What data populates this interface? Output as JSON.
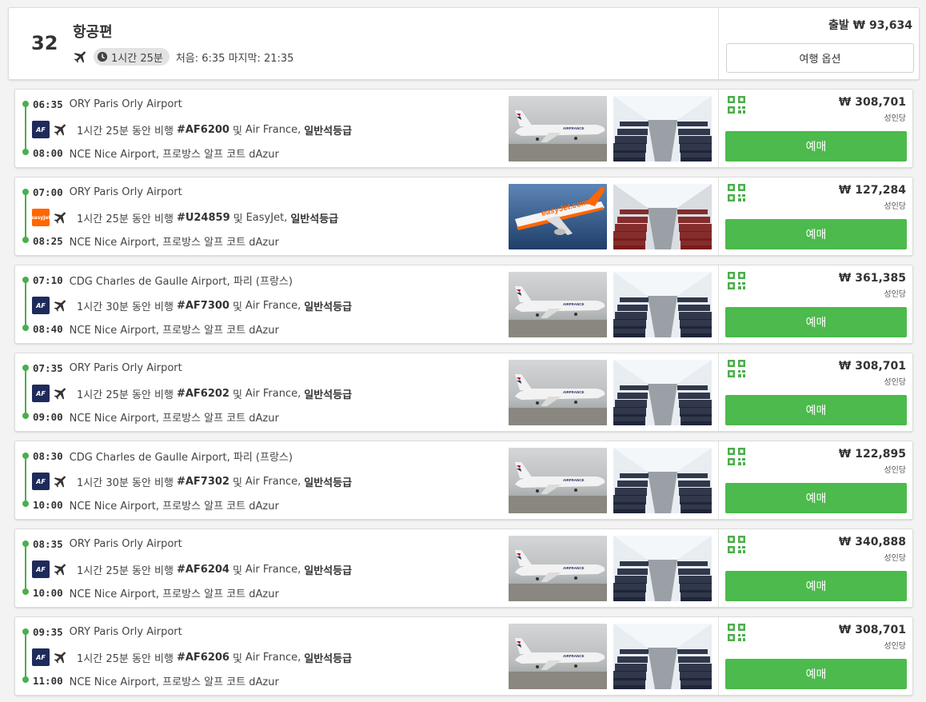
{
  "summary": {
    "count": "32",
    "title": "항공편",
    "duration": "1시간 25분",
    "first_last": "처음: 6:35 마지막: 21:35",
    "depart_price": "출발 ₩ 93,634",
    "options_label": "여행 옵션"
  },
  "book_label": "예매",
  "per_person": "성인당",
  "colors": {
    "accent_green": "#4cba4c",
    "airfrance_navy": "#1f2a5c",
    "easyjet_orange": "#ff6600"
  },
  "flights": [
    {
      "dep_time": "06:35",
      "dep_place": "ORY Paris Orly Airport",
      "duration": "1시간 25분 동안 비행",
      "flight_no": "#AF6200",
      "and": "및",
      "airline": "Air France,",
      "cabin": "일반석등급",
      "arr_time": "08:00",
      "arr_place": "NCE Nice Airport, 프로방스 알프 코트 dAzur",
      "price": "₩ 308,701",
      "logo": "AF"
    },
    {
      "dep_time": "07:00",
      "dep_place": "ORY Paris Orly Airport",
      "duration": "1시간 25분 동안 비행",
      "flight_no": "#U24859",
      "and": "및",
      "airline": "EasyJet,",
      "cabin": "일반석등급",
      "arr_time": "08:25",
      "arr_place": "NCE Nice Airport, 프로방스 알프 코트 dAzur",
      "price": "₩ 127,284",
      "logo": "easyJet"
    },
    {
      "dep_time": "07:10",
      "dep_place": "CDG Charles de Gaulle Airport, 파리 (프랑스)",
      "duration": "1시간 30분 동안 비행",
      "flight_no": "#AF7300",
      "and": "및",
      "airline": "Air France,",
      "cabin": "일반석등급",
      "arr_time": "08:40",
      "arr_place": "NCE Nice Airport, 프로방스 알프 코트 dAzur",
      "price": "₩ 361,385",
      "logo": "AF"
    },
    {
      "dep_time": "07:35",
      "dep_place": "ORY Paris Orly Airport",
      "duration": "1시간 25분 동안 비행",
      "flight_no": "#AF6202",
      "and": "및",
      "airline": "Air France,",
      "cabin": "일반석등급",
      "arr_time": "09:00",
      "arr_place": "NCE Nice Airport, 프로방스 알프 코트 dAzur",
      "price": "₩ 308,701",
      "logo": "AF"
    },
    {
      "dep_time": "08:30",
      "dep_place": "CDG Charles de Gaulle Airport, 파리 (프랑스)",
      "duration": "1시간 30분 동안 비행",
      "flight_no": "#AF7302",
      "and": "및",
      "airline": "Air France,",
      "cabin": "일반석등급",
      "arr_time": "10:00",
      "arr_place": "NCE Nice Airport, 프로방스 알프 코트 dAzur",
      "price": "₩ 122,895",
      "logo": "AF"
    },
    {
      "dep_time": "08:35",
      "dep_place": "ORY Paris Orly Airport",
      "duration": "1시간 25분 동안 비행",
      "flight_no": "#AF6204",
      "and": "및",
      "airline": "Air France,",
      "cabin": "일반석등급",
      "arr_time": "10:00",
      "arr_place": "NCE Nice Airport, 프로방스 알프 코트 dAzur",
      "price": "₩ 340,888",
      "logo": "AF"
    },
    {
      "dep_time": "09:35",
      "dep_place": "ORY Paris Orly Airport",
      "duration": "1시간 25분 동안 비행",
      "flight_no": "#AF6206",
      "and": "및",
      "airline": "Air France,",
      "cabin": "일반석등급",
      "arr_time": "11:00",
      "arr_place": "NCE Nice Airport, 프로방스 알프 코트 dAzur",
      "price": "₩ 308,701",
      "logo": "AF"
    }
  ]
}
